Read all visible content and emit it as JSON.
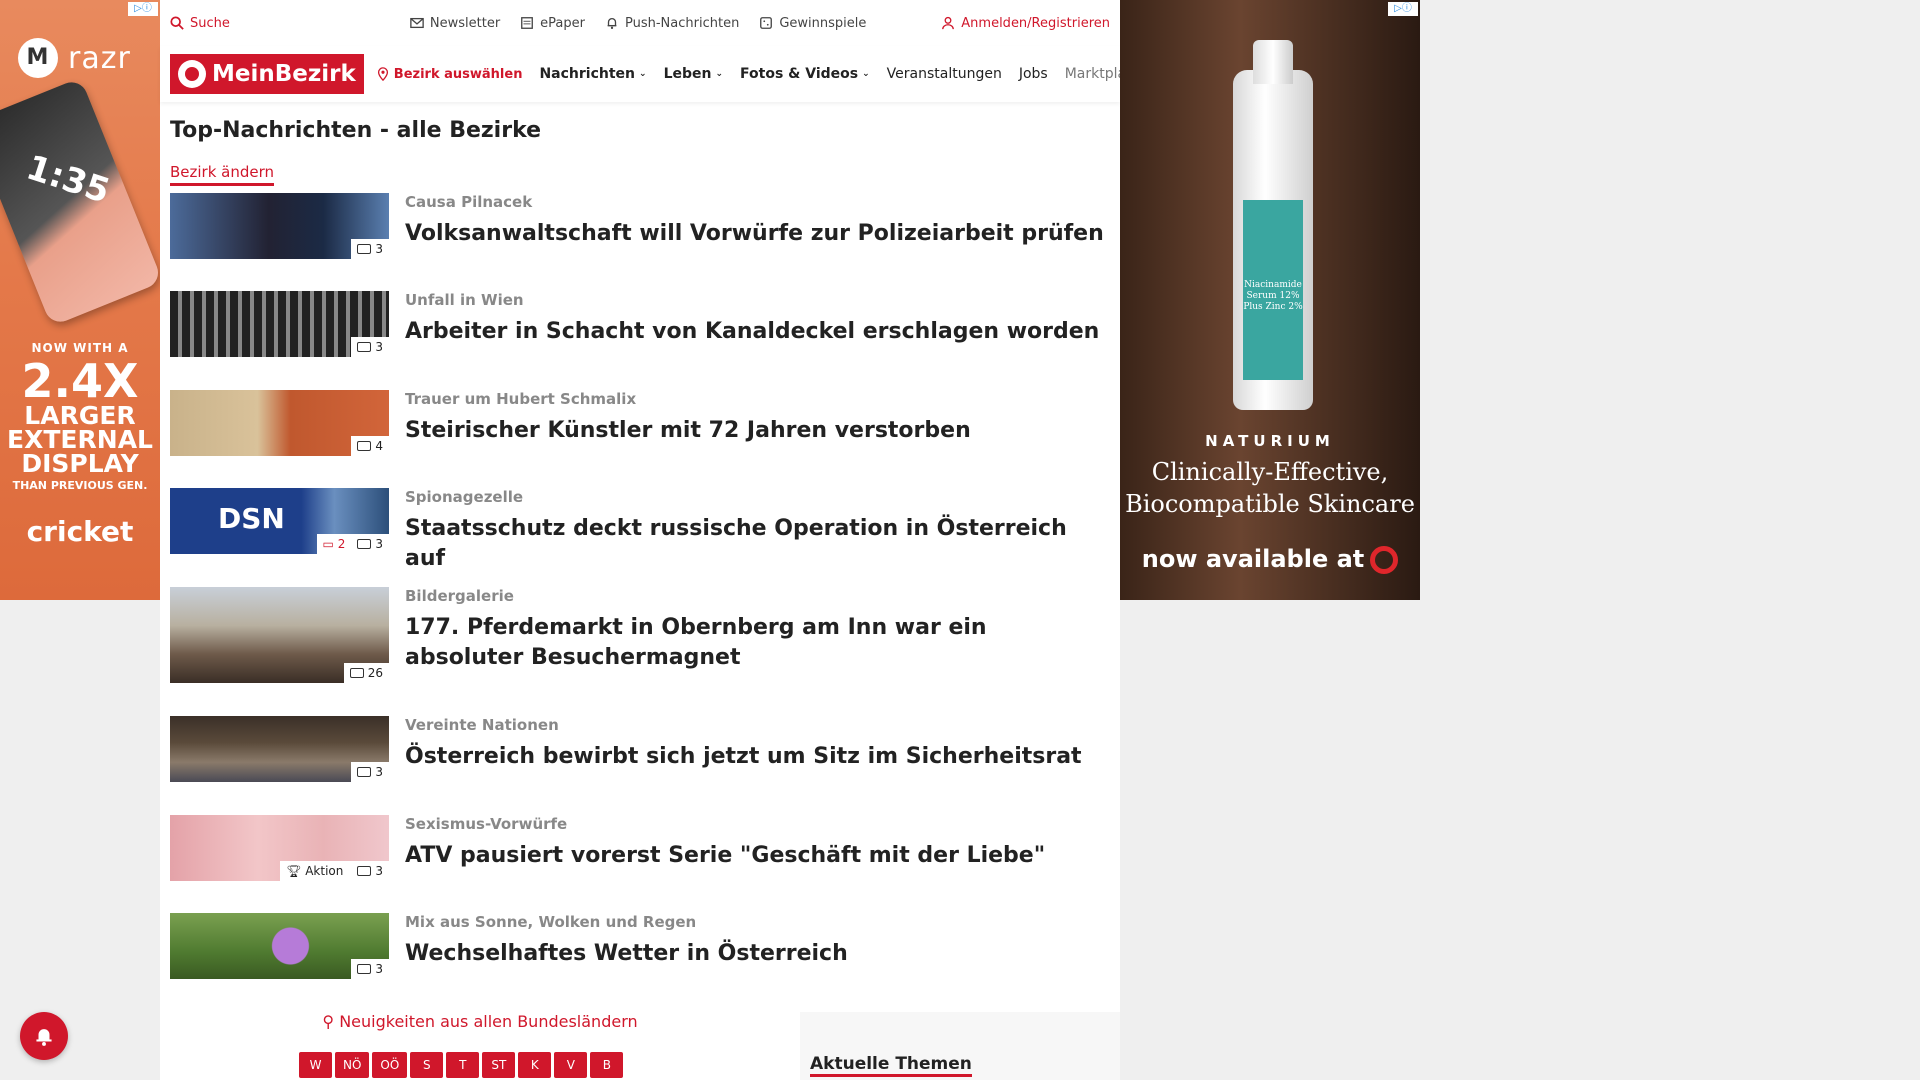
{
  "topbar": {
    "search": "Suche",
    "newsletter": "Newsletter",
    "epaper": "ePaper",
    "push": "Push-Nachrichten",
    "games": "Gewinnspiele",
    "login": "Anmelden/Registrieren"
  },
  "nav": {
    "logo": "MeinBezirk",
    "district": "Bezirk auswählen",
    "items": [
      "Nachrichten",
      "Leben",
      "Fotos & Videos",
      "Veranstaltungen",
      "Jobs",
      "Marktplatz"
    ]
  },
  "page": {
    "title": "Top-Nachrichten - alle Bezirke",
    "change_district": "Bezirk ändern"
  },
  "news": [
    {
      "kicker": "Causa Pilnacek",
      "headline": "Volksanwaltschaft will Vorwürfe zur Polizeiarbeit prüfen",
      "photos": "3",
      "comments": "",
      "badge": ""
    },
    {
      "kicker": "Unfall in Wien",
      "headline": "Arbeiter in Schacht von Kanaldeckel erschlagen worden",
      "photos": "3",
      "comments": "",
      "badge": ""
    },
    {
      "kicker": "Trauer um Hubert Schmalix",
      "headline": "Steirischer Künstler mit 72 Jahren verstorben",
      "photos": "4",
      "comments": "",
      "badge": ""
    },
    {
      "kicker": "Spionagezelle",
      "headline": "Staatsschutz deckt russische Operation in Österreich auf",
      "photos": "3",
      "comments": "2",
      "badge": "",
      "thumb_text": "DSN"
    },
    {
      "kicker": "Bildergalerie",
      "headline": "177. Pferdemarkt in Obernberg am Inn war ein absoluter Besuchermagnet",
      "photos": "26",
      "comments": "",
      "badge": ""
    },
    {
      "kicker": "Vereinte Nationen",
      "headline": "Österreich bewirbt sich jetzt um Sitz im Sicherheitsrat",
      "photos": "3",
      "comments": "",
      "badge": ""
    },
    {
      "kicker": "Sexismus-Vorwürfe",
      "headline": "ATV pausiert vorerst Serie \"Geschäft mit der Liebe\"",
      "photos": "3",
      "comments": "",
      "badge": "Aktion"
    },
    {
      "kicker": "Mix aus Sonne, Wolken und Regen",
      "headline": "Wechselhaftes Wetter in Österreich",
      "photos": "3",
      "comments": "",
      "badge": ""
    }
  ],
  "bottom": {
    "states_label": "Neuigkeiten aus allen Bundesländern",
    "states": [
      "W",
      "NÖ",
      "OÖ",
      "S",
      "T",
      "ST",
      "K",
      "V",
      "B"
    ],
    "topics": "Aktuelle Themen"
  },
  "ad_left": {
    "brand": "razr",
    "time": "1:35",
    "line1": "NOW WITH A",
    "line2": "2.4X",
    "line3": "LARGER",
    "line4": "EXTERNAL",
    "line5": "DISPLAY",
    "line6": "THAN PREVIOUS GEN.",
    "carrier": "cricket"
  },
  "ad_right": {
    "brand": "NATURIUM",
    "label": "Niacinamide Serum 12% Plus Zinc 2%",
    "claim1": "Clinically-Effective,",
    "claim2": "Biocompatible Skincare",
    "cta": "now available at"
  },
  "colors": {
    "accent": "#d0172b"
  }
}
